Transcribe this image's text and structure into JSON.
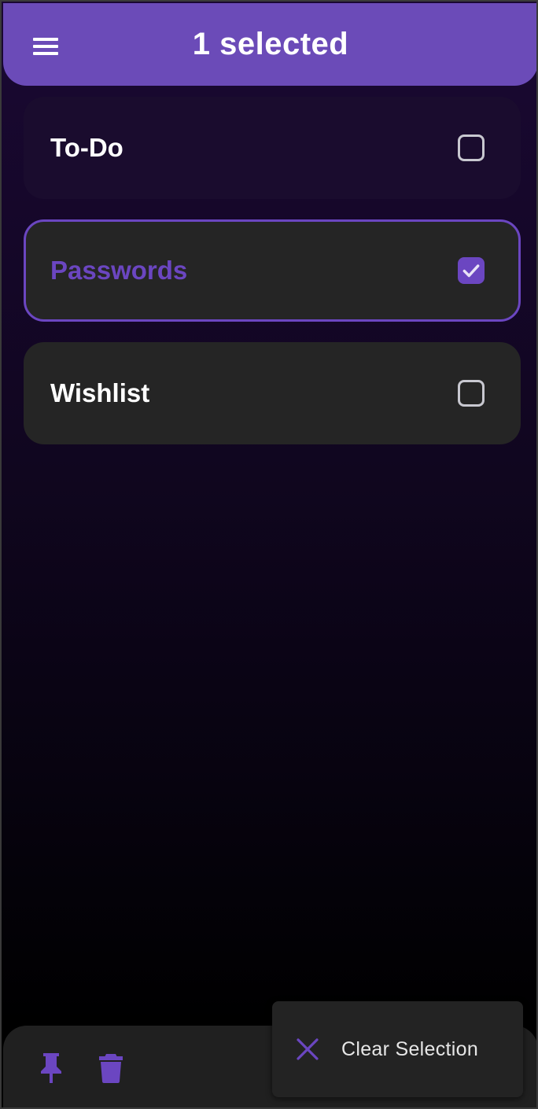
{
  "appbar": {
    "title": "1 selected",
    "menu_icon": "menu-icon"
  },
  "lists": [
    {
      "label": "To-Do",
      "selected": false
    },
    {
      "label": "Passwords",
      "selected": true
    },
    {
      "label": "Wishlist",
      "selected": false
    }
  ],
  "bottom_bar": {
    "pin_icon": "pin-icon",
    "delete_icon": "trash-icon"
  },
  "fab": {
    "icon": "close-icon",
    "label": "Clear Selection"
  },
  "colors": {
    "accent": "#6b46c1",
    "appbar": "#6b4bb8",
    "card": "#252525",
    "bottom_bar": "#202020"
  }
}
